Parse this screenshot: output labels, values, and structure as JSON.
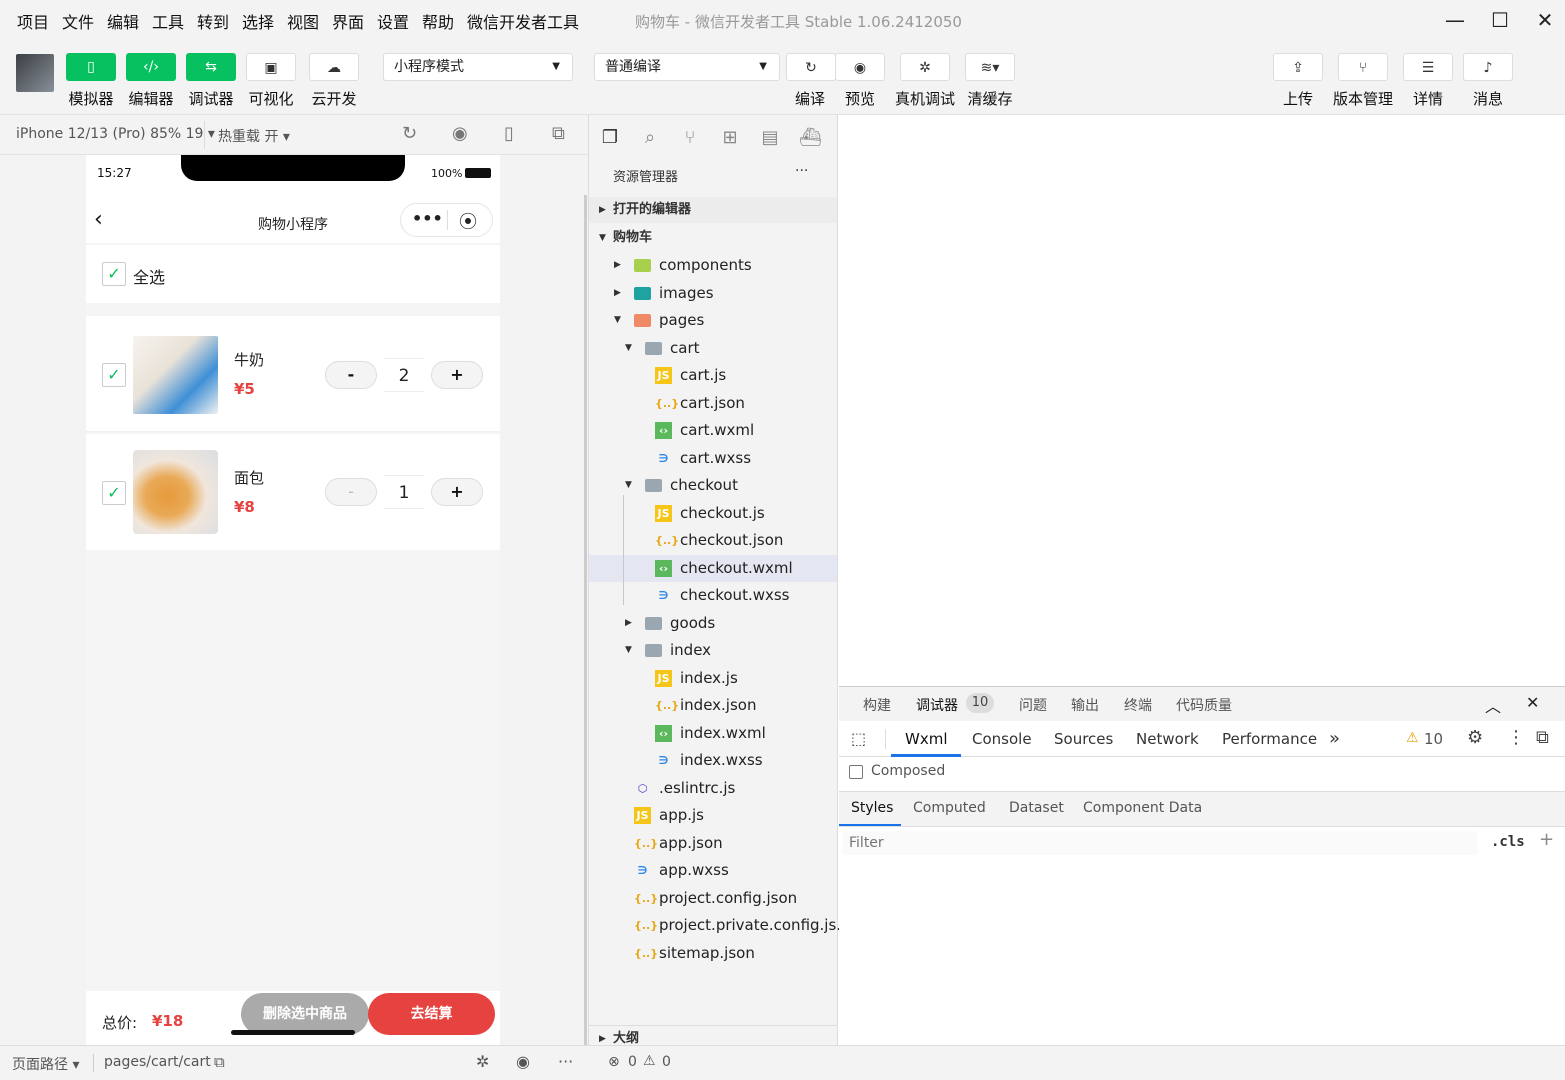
{
  "menu": [
    "项目",
    "文件",
    "编辑",
    "工具",
    "转到",
    "选择",
    "视图",
    "界面",
    "设置",
    "帮助",
    "微信开发者工具"
  ],
  "window_title": "购物车 - 微信开发者工具 Stable 1.06.2412050",
  "toolbar": {
    "simulator": "模拟器",
    "editor": "编辑器",
    "debugger": "调试器",
    "visual": "可视化",
    "cloud": "云开发",
    "mode": "小程序模式",
    "compile_mode": "普通编译",
    "compile": "编译",
    "preview": "预览",
    "remote_debug": "真机调试",
    "clear_cache": "清缓存",
    "upload": "上传",
    "version": "版本管理",
    "details": "详情",
    "messages": "消息"
  },
  "simbar": {
    "device": "iPhone 12/13 (Pro) 85% 19 ▾",
    "hot_reload": "热重载 开 ▾"
  },
  "phone": {
    "time": "15:27",
    "battery": "100%",
    "nav_title": "购物小程序",
    "select_all": "全选",
    "items": [
      {
        "name": "牛奶",
        "price": "¥5",
        "qty": "2",
        "minus": "-",
        "plus": "+"
      },
      {
        "name": "面包",
        "price": "¥8",
        "qty": "1",
        "minus": "-",
        "plus": "+"
      }
    ],
    "total_label": "总价:",
    "total_value": "¥18",
    "delete_btn": "删除选中商品",
    "checkout_btn": "去结算"
  },
  "explorer": {
    "title": "资源管理器",
    "more": "···",
    "open_editors": "打开的编辑器",
    "project": "购物车",
    "outline": "大纲",
    "tree": [
      {
        "label": "components",
        "depth": 0,
        "type": "folder-c",
        "caret": "▶"
      },
      {
        "label": "images",
        "depth": 0,
        "type": "folder-i",
        "caret": "▶"
      },
      {
        "label": "pages",
        "depth": 0,
        "type": "folder-p",
        "caret": "▼"
      },
      {
        "label": "cart",
        "depth": 1,
        "type": "folder",
        "caret": "▼"
      },
      {
        "label": "cart.js",
        "depth": 2,
        "type": "js"
      },
      {
        "label": "cart.json",
        "depth": 2,
        "type": "json"
      },
      {
        "label": "cart.wxml",
        "depth": 2,
        "type": "wxml"
      },
      {
        "label": "cart.wxss",
        "depth": 2,
        "type": "wxss"
      },
      {
        "label": "checkout",
        "depth": 1,
        "type": "folder",
        "caret": "▼"
      },
      {
        "label": "checkout.js",
        "depth": 2,
        "type": "js"
      },
      {
        "label": "checkout.json",
        "depth": 2,
        "type": "json"
      },
      {
        "label": "checkout.wxml",
        "depth": 2,
        "type": "wxml",
        "selected": true
      },
      {
        "label": "checkout.wxss",
        "depth": 2,
        "type": "wxss"
      },
      {
        "label": "goods",
        "depth": 1,
        "type": "folder",
        "caret": "▶"
      },
      {
        "label": "index",
        "depth": 1,
        "type": "folder",
        "caret": "▼"
      },
      {
        "label": "index.js",
        "depth": 2,
        "type": "js"
      },
      {
        "label": "index.json",
        "depth": 2,
        "type": "json"
      },
      {
        "label": "index.wxml",
        "depth": 2,
        "type": "wxml"
      },
      {
        "label": "index.wxss",
        "depth": 2,
        "type": "wxss"
      },
      {
        "label": ".eslintrc.js",
        "depth": 0,
        "type": "eslint"
      },
      {
        "label": "app.js",
        "depth": 0,
        "type": "js"
      },
      {
        "label": "app.json",
        "depth": 0,
        "type": "json"
      },
      {
        "label": "app.wxss",
        "depth": 0,
        "type": "wxss"
      },
      {
        "label": "project.config.json",
        "depth": 0,
        "type": "json"
      },
      {
        "label": "project.private.config.js...",
        "depth": 0,
        "type": "json"
      },
      {
        "label": "sitemap.json",
        "depth": 0,
        "type": "json"
      }
    ]
  },
  "devtools": {
    "top_tabs": [
      "构建",
      "调试器",
      "问题",
      "输出",
      "终端",
      "代码质量"
    ],
    "debugger_badge": "10",
    "tabs": [
      "Wxml",
      "Console",
      "Sources",
      "Network",
      "Performance"
    ],
    "more_tabs": "»",
    "warn_count": "10",
    "composed": "Composed",
    "sub_tabs": [
      "Styles",
      "Computed",
      "Dataset",
      "Component Data"
    ],
    "filter_placeholder": "Filter",
    "cls": ".cls",
    "plus": "+"
  },
  "statusbar": {
    "path_label": "页面路径 ▾",
    "path": "pages/cart/cart",
    "errors": "0",
    "warnings": "0"
  }
}
